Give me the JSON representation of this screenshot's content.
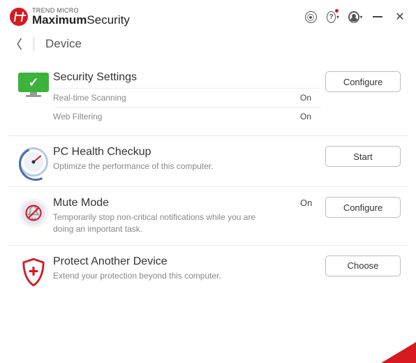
{
  "brand": {
    "top": "TREND MICRO",
    "bold": "Maximum",
    "thin": "Security"
  },
  "page": {
    "title": "Device"
  },
  "sections": {
    "security": {
      "title": "Security Settings",
      "button": "Configure",
      "rows": [
        {
          "label": "Real-time Scanning",
          "value": "On"
        },
        {
          "label": "Web Filtering",
          "value": "On"
        }
      ]
    },
    "health": {
      "title": "PC Health Checkup",
      "desc": "Optimize the performance of this computer.",
      "button": "Start"
    },
    "mute": {
      "title": "Mute Mode",
      "status": "On",
      "desc": "Temporarily stop non-critical notifications while you are doing an important task.",
      "button": "Configure"
    },
    "protect": {
      "title": "Protect Another Device",
      "desc": "Extend your protection beyond this computer.",
      "button": "Choose"
    }
  }
}
